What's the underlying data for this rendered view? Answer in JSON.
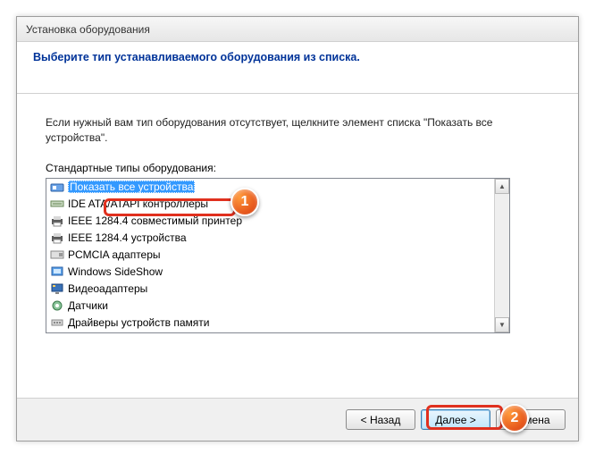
{
  "window": {
    "title": "Установка оборудования"
  },
  "header": {
    "title": "Выберите тип устанавливаемого оборудования из списка."
  },
  "help_text": "Если нужный вам тип оборудования отсутствует, щелкните элемент списка \"Показать все устройства\".",
  "list_label": "Стандартные типы оборудования:",
  "list": {
    "items": [
      {
        "label": "Показать все устройства",
        "icon": "all"
      },
      {
        "label": "IDE ATA/ATAPI контроллеры",
        "icon": "ide"
      },
      {
        "label": "IEEE 1284.4 совместимый принтер",
        "icon": "printer"
      },
      {
        "label": "IEEE 1284.4 устройства",
        "icon": "printer"
      },
      {
        "label": "PCMCIA адаптеры",
        "icon": "pcmcia"
      },
      {
        "label": "Windows SideShow",
        "icon": "sideshow"
      },
      {
        "label": "Видеоадаптеры",
        "icon": "display"
      },
      {
        "label": "Датчики",
        "icon": "sensor"
      },
      {
        "label": "Драйверы устройств памяти",
        "icon": "memory"
      }
    ],
    "selected_index": 0
  },
  "buttons": {
    "back": "< Назад",
    "next": "Далее >",
    "cancel": "Отмена"
  },
  "callouts": {
    "one": "1",
    "two": "2"
  }
}
